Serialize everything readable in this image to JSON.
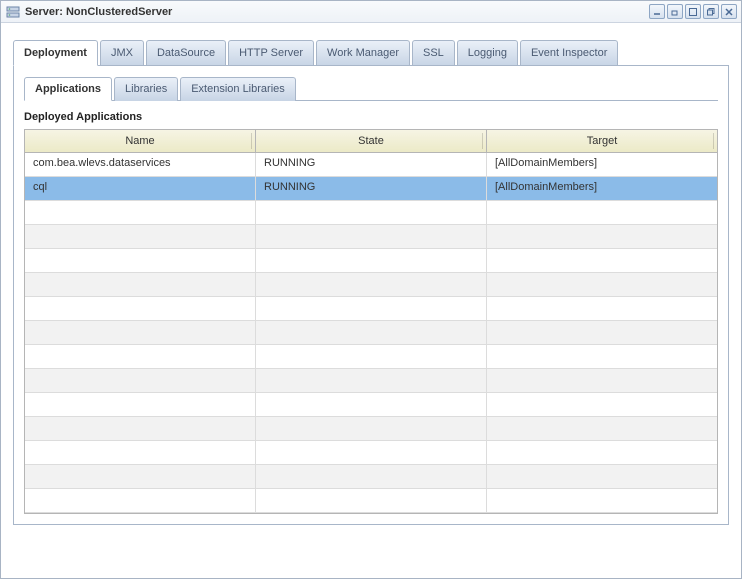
{
  "titlebar": {
    "title": "Server: NonClusteredServer"
  },
  "tabs": [
    {
      "label": "Deployment",
      "active": true
    },
    {
      "label": "JMX",
      "active": false
    },
    {
      "label": "DataSource",
      "active": false
    },
    {
      "label": "HTTP Server",
      "active": false
    },
    {
      "label": "Work Manager",
      "active": false
    },
    {
      "label": "SSL",
      "active": false
    },
    {
      "label": "Logging",
      "active": false
    },
    {
      "label": "Event Inspector",
      "active": false
    }
  ],
  "subtabs": [
    {
      "label": "Applications",
      "active": true
    },
    {
      "label": "Libraries",
      "active": false
    },
    {
      "label": "Extension Libraries",
      "active": false
    }
  ],
  "section_title": "Deployed Applications",
  "columns": [
    "Name",
    "State",
    "Target"
  ],
  "rows": [
    {
      "name": "com.bea.wlevs.dataservices",
      "state": "RUNNING",
      "target": "[AllDomainMembers]",
      "selected": false
    },
    {
      "name": "cql",
      "state": "RUNNING",
      "target": "[AllDomainMembers]",
      "selected": true
    }
  ],
  "empty_row_count": 13
}
